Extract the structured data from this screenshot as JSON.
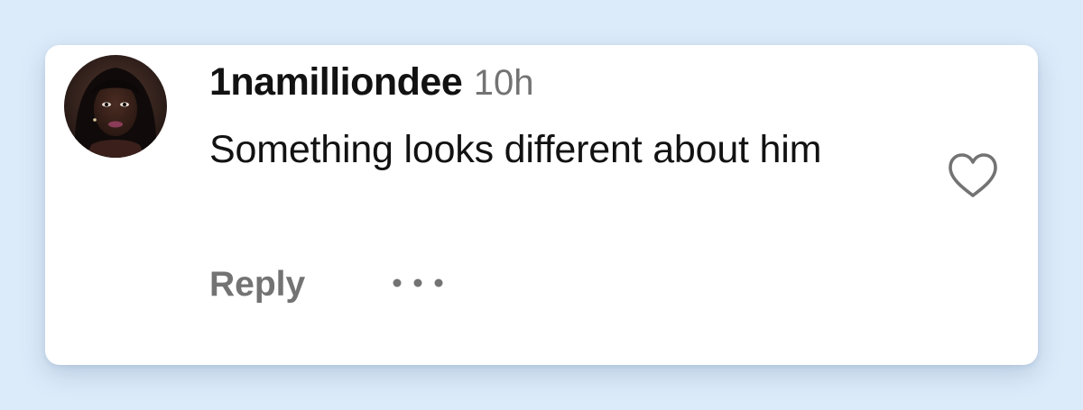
{
  "comment": {
    "username": "1namilliondee",
    "timestamp": "10h",
    "text": "Something looks different about him",
    "actions": {
      "reply_label": "Reply",
      "more_icon": "more-horizontal-icon",
      "like_icon": "heart-outline-icon"
    },
    "avatar_icon": "user-avatar"
  },
  "colors": {
    "page_background": "#dcebfa",
    "card_background": "#ffffff",
    "primary_text": "#121212",
    "secondary_text": "#737373"
  }
}
